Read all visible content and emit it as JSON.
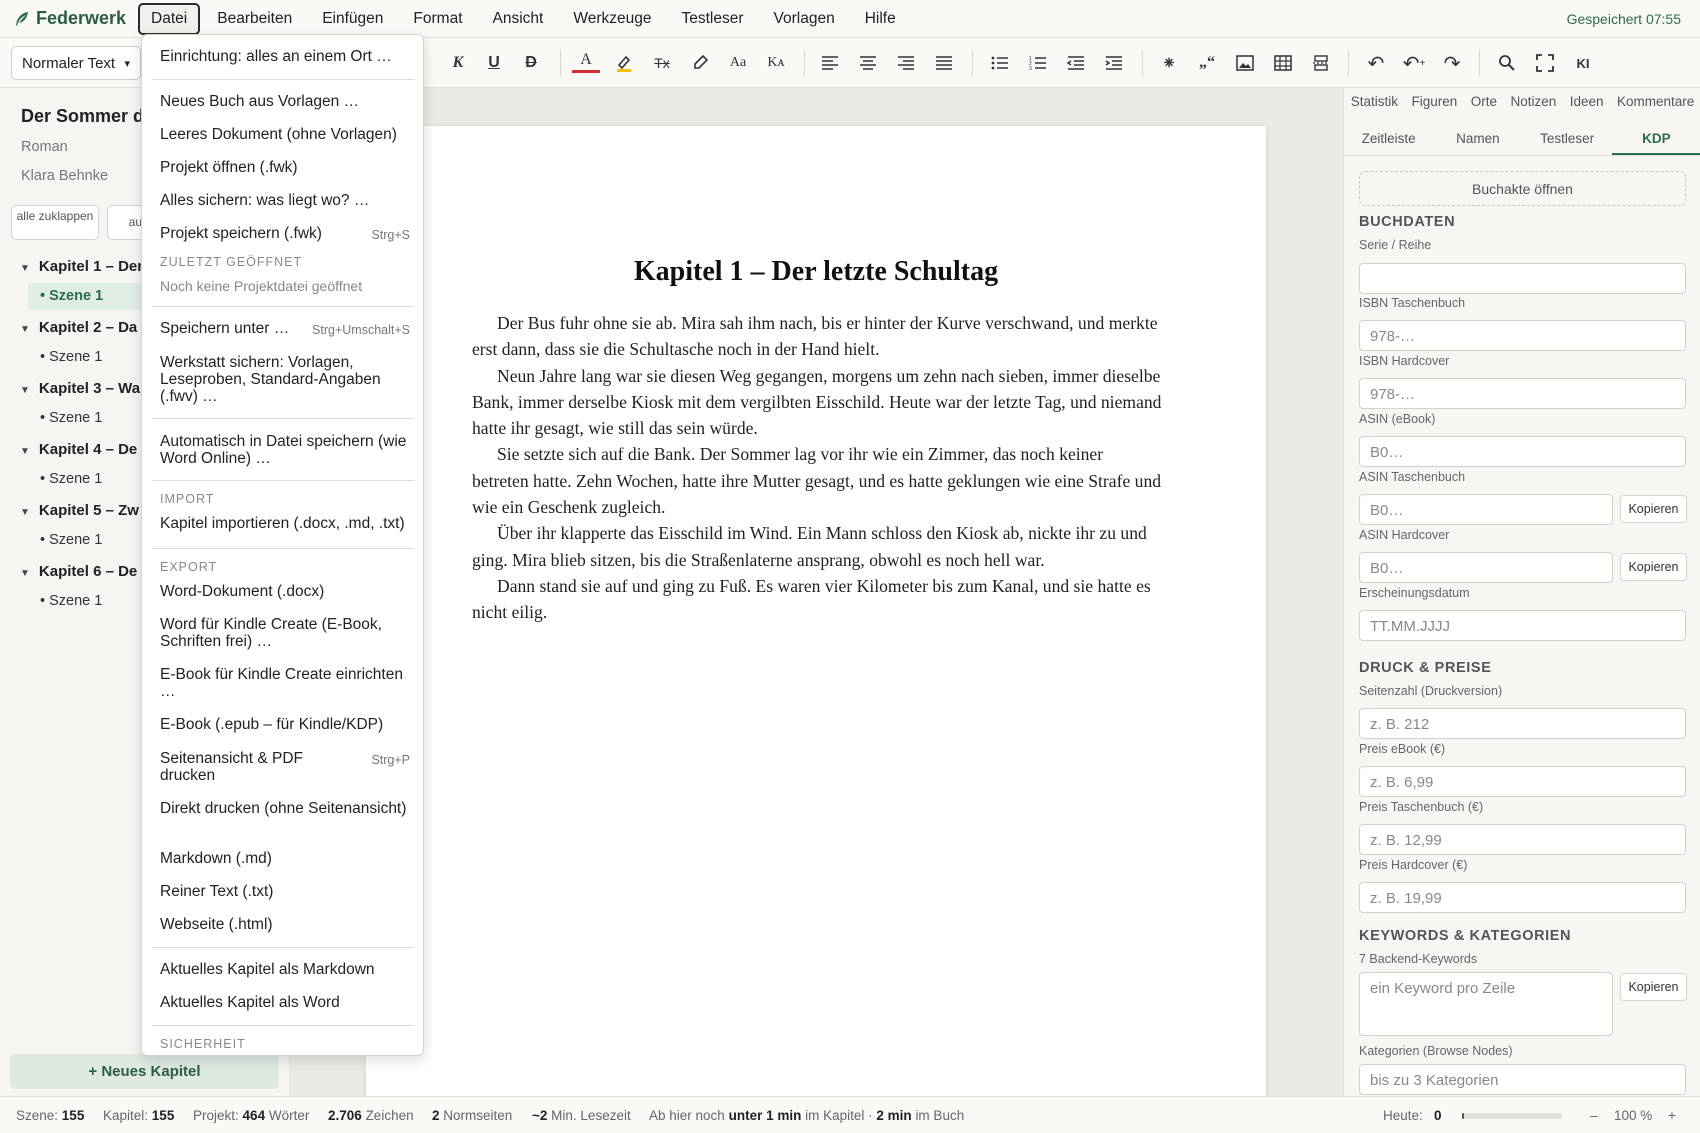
{
  "app": {
    "name": "Federwerk",
    "saved_status": "Gespeichert 07:55",
    "accent": "#2b6d48"
  },
  "menubar": {
    "items": [
      "Datei",
      "Bearbeiten",
      "Einfügen",
      "Format",
      "Ansicht",
      "Werkzeuge",
      "Testleser",
      "Vorlagen",
      "Hilfe"
    ]
  },
  "toolbar": {
    "style_select": "Normaler Text",
    "buttons": {
      "italic": "K",
      "underline": "U",
      "strike": "D",
      "font_color": "A",
      "clear_format": "Tx",
      "case": "Aa",
      "small_caps": "Kᴀ",
      "quotes": "„“",
      "ai": "KI"
    }
  },
  "sidebar": {
    "title": "Der Sommer da",
    "genre": "Roman",
    "author": "Klara Behnke",
    "collapse_all": "alle zuklappen",
    "expand_all": "auf",
    "chapters": [
      {
        "label": "Kapitel 1 – Der",
        "scene": "Szene 1"
      },
      {
        "label": "Kapitel 2 – Da",
        "scene": "Szene 1"
      },
      {
        "label": "Kapitel 3 – Wa",
        "scene": "Szene 1"
      },
      {
        "label": "Kapitel 4 – De",
        "scene": "Szene 1"
      },
      {
        "label": "Kapitel 5 – Zw",
        "scene": "Szene 1"
      },
      {
        "label": "Kapitel 6 – De",
        "scene": "Szene 1"
      }
    ],
    "new_chapter": "+ Neues Kapitel"
  },
  "editor": {
    "heading": "Kapitel 1 – Der letzte Schultag",
    "paragraphs": [
      "Der Bus fuhr ohne sie ab. Mira sah ihm nach, bis er hinter der Kurve verschwand, und merkte erst dann, dass sie die Schultasche noch in der Hand hielt.",
      "Neun Jahre lang war sie diesen Weg gegangen, morgens um zehn nach sieben, immer dieselbe Bank, immer derselbe Kiosk mit dem vergilbten Eisschild. Heute war der letzte Tag, und niemand hatte ihr gesagt, wie still das sein würde.",
      "Sie setzte sich auf die Bank. Der Sommer lag vor ihr wie ein Zimmer, das noch keiner betreten hatte. Zehn Wochen, hatte ihre Mutter gesagt, und es hatte geklungen wie eine Strafe und wie ein Geschenk zugleich.",
      "Über ihr klapperte das Eisschild im Wind. Ein Mann schloss den Kiosk ab, nickte ihr zu und ging. Mira blieb sitzen, bis die Straßenlaterne ansprang, obwohl es noch hell war.",
      "Dann stand sie auf und ging zu Fuß. Es waren vier Kilometer bis zum Kanal, und sie hatte es nicht eilig."
    ]
  },
  "right_panel": {
    "tabs_row1": [
      "Statistik",
      "Figuren",
      "Orte",
      "Notizen",
      "Ideen",
      "Kommentare"
    ],
    "tabs_row2": [
      "Zeitleiste",
      "Namen",
      "Testleser",
      "KDP"
    ],
    "open_buchakte": "Buchakte öffnen",
    "sections": {
      "buchdaten": "BUCHDATEN",
      "druck": "DRUCK & PREISE",
      "keywords": "KEYWORDS & KATEGORIEN"
    },
    "fields": {
      "serie": {
        "label": "Serie / Reihe",
        "placeholder": ""
      },
      "isbn_tb": {
        "label": "ISBN Taschenbuch",
        "placeholder": "978-…"
      },
      "isbn_hc": {
        "label": "ISBN Hardcover",
        "placeholder": "978-…"
      },
      "asin_ebook": {
        "label": "ASIN (eBook)",
        "placeholder": "B0…"
      },
      "asin_tb": {
        "label": "ASIN Taschenbuch",
        "placeholder": "B0…"
      },
      "asin_hc": {
        "label": "ASIN Hardcover",
        "placeholder": "B0…"
      },
      "datum": {
        "label": "Erscheinungsdatum",
        "placeholder": "TT.MM.JJJJ"
      },
      "seitenzahl": {
        "label": "Seitenzahl (Druckversion)",
        "placeholder": "z. B. 212"
      },
      "preis_ebook": {
        "label": "Preis eBook (€)",
        "placeholder": "z. B. 6,99"
      },
      "preis_tb": {
        "label": "Preis Taschenbuch (€)",
        "placeholder": "z. B. 12,99"
      },
      "preis_hc": {
        "label": "Preis Hardcover (€)",
        "placeholder": "z. B. 19,99"
      },
      "keywords": {
        "label": "7 Backend-Keywords",
        "placeholder": "ein Keyword pro Zeile"
      },
      "kategorien": {
        "label": "Kategorien (Browse Nodes)",
        "placeholder": "bis zu 3 Kategorien"
      }
    },
    "copy_label": "Kopieren"
  },
  "statusbar": {
    "scene_label": "Szene:",
    "scene_value": "155",
    "chapter_label": "Kapitel:",
    "chapter_value": "155",
    "project_label": "Projekt:",
    "project_value": "464",
    "words": "Wörter",
    "chars_value": "2.706",
    "chars_label": "Zeichen",
    "norm_value": "2",
    "norm_label": "Normseiten",
    "read_value": "~2",
    "read_label": "Min. Lesezeit",
    "remaining_prefix": "Ab hier noch",
    "remaining_chapter": "unter 1 min",
    "remaining_mid": "im Kapitel ·",
    "remaining_book": "2 min",
    "remaining_suffix": "im Buch",
    "today_label": "Heute:",
    "today_value": "0",
    "today_progress": 0.02,
    "zoom": "100 %",
    "zoom_minus": "–",
    "zoom_plus": "+"
  },
  "file_menu": {
    "items": {
      "setup": "Einrichtung: alles an einem Ort …",
      "new_from_template": "Neues Buch aus Vorlagen …",
      "empty_doc": "Leeres Dokument (ohne Vorlagen)",
      "open_project": "Projekt öffnen (.fwk)",
      "save_all": "Alles sichern: was liegt wo? …",
      "save_project": "Projekt speichern (.fwk)",
      "save_project_shortcut": "Strg+S",
      "recent_head": "ZULETZT GEÖFFNET",
      "recent_none": "Noch keine Projektdatei geöffnet",
      "save_as": "Speichern unter …",
      "save_as_shortcut": "Strg+Umschalt+S",
      "workshop": "Werkstatt sichern: Vorlagen, Leseproben, Standard-Angaben (.fwv) …",
      "autosave": "Automatisch in Datei speichern (wie Word Online) …",
      "import_head": "IMPORT",
      "import_chapter": "Kapitel importieren (.docx, .md, .txt)",
      "export_head": "EXPORT",
      "word": "Word-Dokument (.docx)",
      "word_kindle": "Word für Kindle Create (E-Book, Schriften frei) …",
      "ebook_kindle": "E-Book für Kindle Create einrichten …",
      "epub": "E-Book (.epub – für Kindle/KDP)",
      "print_pdf": "Seitenansicht & PDF drucken",
      "print_pdf_shortcut": "Strg+P",
      "print_direct": "Direkt drucken (ohne Seitenansicht)",
      "markdown": "Markdown (.md)",
      "txt": "Reiner Text (.txt)",
      "html": "Webseite (.html)",
      "chapter_md": "Aktuelles Kapitel als Markdown",
      "chapter_word": "Aktuelles Kapitel als Word",
      "security_head": "SICHERHEIT"
    }
  }
}
